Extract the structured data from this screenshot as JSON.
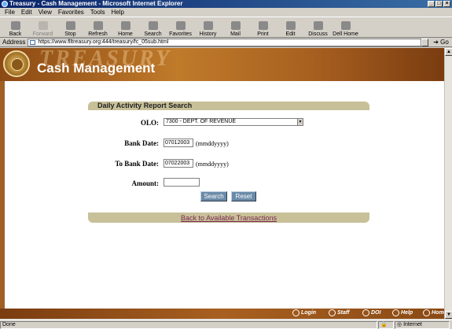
{
  "window": {
    "title": "Treasury - Cash Management - Microsoft Internet Explorer"
  },
  "menu": [
    "File",
    "Edit",
    "View",
    "Favorites",
    "Tools",
    "Help"
  ],
  "toolbar": [
    {
      "label": "Back",
      "icon": "back-arrow-icon",
      "enabled": true
    },
    {
      "label": "Forward",
      "icon": "forward-arrow-icon",
      "enabled": false
    },
    {
      "label": "Stop",
      "icon": "stop-icon",
      "enabled": true
    },
    {
      "label": "Refresh",
      "icon": "refresh-icon",
      "enabled": true
    },
    {
      "label": "Home",
      "icon": "home-icon",
      "enabled": true
    },
    {
      "label": "Search",
      "icon": "search-icon",
      "enabled": true
    },
    {
      "label": "Favorites",
      "icon": "favorites-icon",
      "enabled": true
    },
    {
      "label": "History",
      "icon": "history-icon",
      "enabled": true
    },
    {
      "label": "Mail",
      "icon": "mail-icon",
      "enabled": true
    },
    {
      "label": "Print",
      "icon": "print-icon",
      "enabled": true
    },
    {
      "label": "Edit",
      "icon": "edit-icon",
      "enabled": true
    },
    {
      "label": "Discuss",
      "icon": "discuss-icon",
      "enabled": true
    },
    {
      "label": "Dell Home",
      "icon": "dell-home-icon",
      "enabled": true
    }
  ],
  "address": {
    "label": "Address",
    "url": "https://www.flltreasury.org:444/treasury/fc_05sub.html",
    "go": "Go"
  },
  "header": {
    "banner_text": "TREASURY",
    "title": "Cash Management"
  },
  "form": {
    "title": "Daily Activity Report Search",
    "olo_label": "OLO:",
    "olo_value": "7300 - DEPT. OF REVENUE",
    "bank_date_label": "Bank Date:",
    "bank_date_value": "07012003",
    "to_bank_date_label": "To Bank Date:",
    "to_bank_date_value": "07022003",
    "date_hint": "(mmddyyyy)",
    "amount_label": "Amount:",
    "amount_value": "",
    "search_label": "Search",
    "reset_label": "Reset",
    "back_link": "Back to Available Transactions"
  },
  "footer_nav": [
    "Login",
    "Staff",
    "DOI",
    "Help",
    "Home"
  ],
  "status": {
    "text": "Done",
    "zone": "Internet"
  },
  "colors": {
    "brown": "#a06024",
    "panel": "#c8c098",
    "button": "#6a8aa8",
    "link": "#7a2850"
  }
}
